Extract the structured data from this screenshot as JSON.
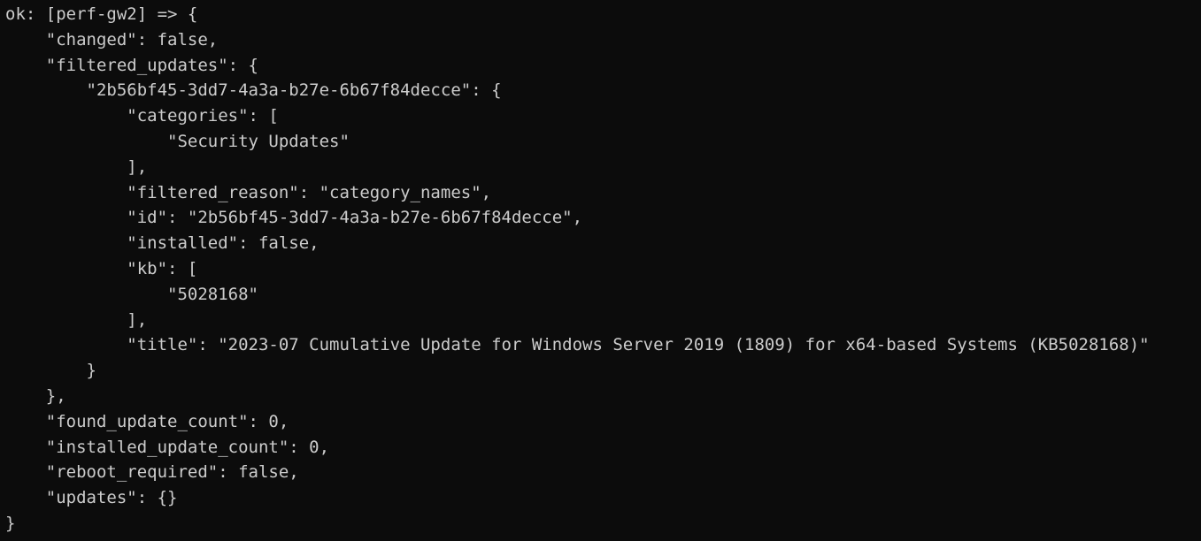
{
  "terminal": {
    "background": "#0c0c0c",
    "foreground": "#cccccc",
    "lines": [
      "ok: [perf-gw2] => {",
      "    \"changed\": false,",
      "    \"filtered_updates\": {",
      "        \"2b56bf45-3dd7-4a3a-b27e-6b67f84decce\": {",
      "            \"categories\": [",
      "                \"Security Updates\"",
      "            ],",
      "            \"filtered_reason\": \"category_names\",",
      "            \"id\": \"2b56bf45-3dd7-4a3a-b27e-6b67f84decce\",",
      "            \"installed\": false,",
      "            \"kb\": [",
      "                \"5028168\"",
      "            ],",
      "            \"title\": \"2023-07 Cumulative Update for Windows Server 2019 (1809) for x64-based Systems (KB5028168)\"",
      "        }",
      "    },",
      "    \"found_update_count\": 0,",
      "    \"installed_update_count\": 0,",
      "    \"reboot_required\": false,",
      "    \"updates\": {}",
      "}"
    ]
  }
}
